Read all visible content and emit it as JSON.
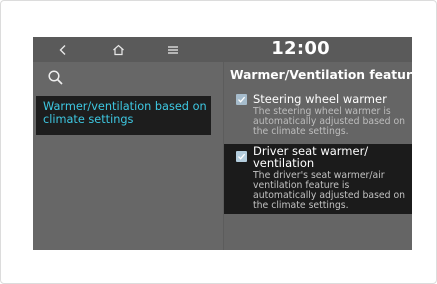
{
  "topbar": {
    "back_icon": "chevron-left-icon",
    "home_icon": "home-icon",
    "menu_icon": "menu-icon",
    "time": "12:00"
  },
  "sidebar": {
    "search_icon": "search-icon",
    "items": [
      {
        "label": "Warmer/ventilation based on climate settings",
        "selected": true
      }
    ]
  },
  "main": {
    "title": "Warmer/Ventilation features",
    "options": [
      {
        "label": "Steering wheel warmer",
        "description": "The steering wheel warmer is automatically adjusted based on the climate settings.",
        "checked": true,
        "focused": false
      },
      {
        "label": "Driver seat warmer/ ventilation",
        "description": "The driver's seat warmer/air ventilation feature is automatically adjusted based on the climate settings.",
        "checked": true,
        "focused": true
      }
    ]
  },
  "colors": {
    "accent": "#3ec8e2",
    "checkbox": "#9fb6c7",
    "panel": "#656565",
    "focus_bg": "#1b1b1b"
  }
}
